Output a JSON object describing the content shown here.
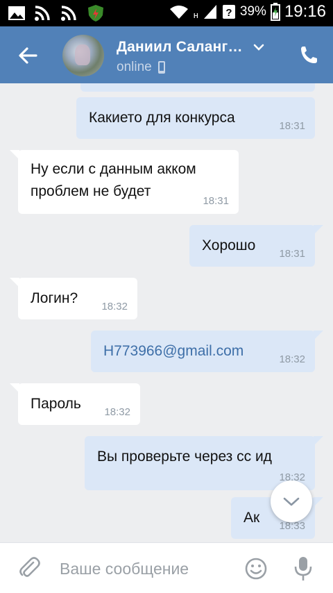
{
  "status_bar": {
    "network_label": "н",
    "battery": "39%",
    "time": "19:16"
  },
  "header": {
    "name": "Даниил Саланг…",
    "status": "online"
  },
  "messages": [
    {
      "dir": "out",
      "text": "",
      "time": ""
    },
    {
      "dir": "out",
      "text": "Какието для конкурса",
      "time": "18:31"
    },
    {
      "dir": "in",
      "text": "Ну если с данным акком",
      "text2": "проблем не будет",
      "time": "18:31"
    },
    {
      "dir": "out",
      "text": "Хорошо",
      "time": "18:31"
    },
    {
      "dir": "in",
      "text": "Логин?",
      "time": "18:32"
    },
    {
      "dir": "out",
      "text": "H773966@gmail.com",
      "time": "18:32"
    },
    {
      "dir": "in",
      "text": "Пароль",
      "time": "18:32"
    },
    {
      "dir": "out",
      "text": "Вы проверьте через сс ид",
      "time": "18:32"
    },
    {
      "dir": "out",
      "text": "Ак",
      "time": "18:33"
    }
  ],
  "input": {
    "placeholder": "Ваше сообщение"
  },
  "colors": {
    "header_bg": "#5181b8",
    "outgoing_bubble": "#dbe7f7",
    "incoming_bubble": "#ffffff",
    "chat_bg": "#edeef0",
    "link": "#3e6fa8"
  },
  "icons": [
    "image-icon",
    "rss-icon",
    "signal-wifi-icon",
    "shield-app-icon",
    "wifi-icon",
    "cell-signal-icon",
    "unknown-sim-icon",
    "battery-icon",
    "back-arrow-icon",
    "chevron-down-icon",
    "phone-icon",
    "mobile-icon",
    "attach-icon",
    "emoji-icon",
    "mic-icon",
    "scroll-down-icon"
  ]
}
